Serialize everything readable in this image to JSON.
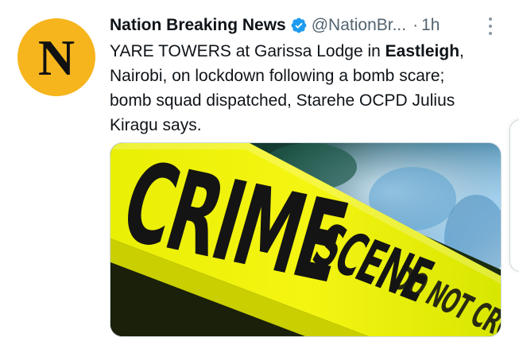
{
  "author": {
    "display_name": "Nation Breaking News",
    "handle": "@NationBr...",
    "avatar_letter": "N",
    "avatar_color": "#f6b51d",
    "verified": true
  },
  "meta": {
    "separator": "·",
    "timestamp": "1h"
  },
  "tweet": {
    "text_part1": "YARE TOWERS at Garissa Lodge in ",
    "text_bold": "Eastleigh",
    "text_part2": ", Nairobi, on lockdown following a bomb scare; bomb squad dispatched, Starehe OCPD Julius Kiragu says."
  },
  "media": {
    "tape_text_main": "CRIME SCENE",
    "tape_text_secondary": "DO NOT CROSS",
    "tape_color": "#f2f20a"
  },
  "icons": {
    "verified": "verified-badge-icon",
    "more": "more-options-icon"
  }
}
